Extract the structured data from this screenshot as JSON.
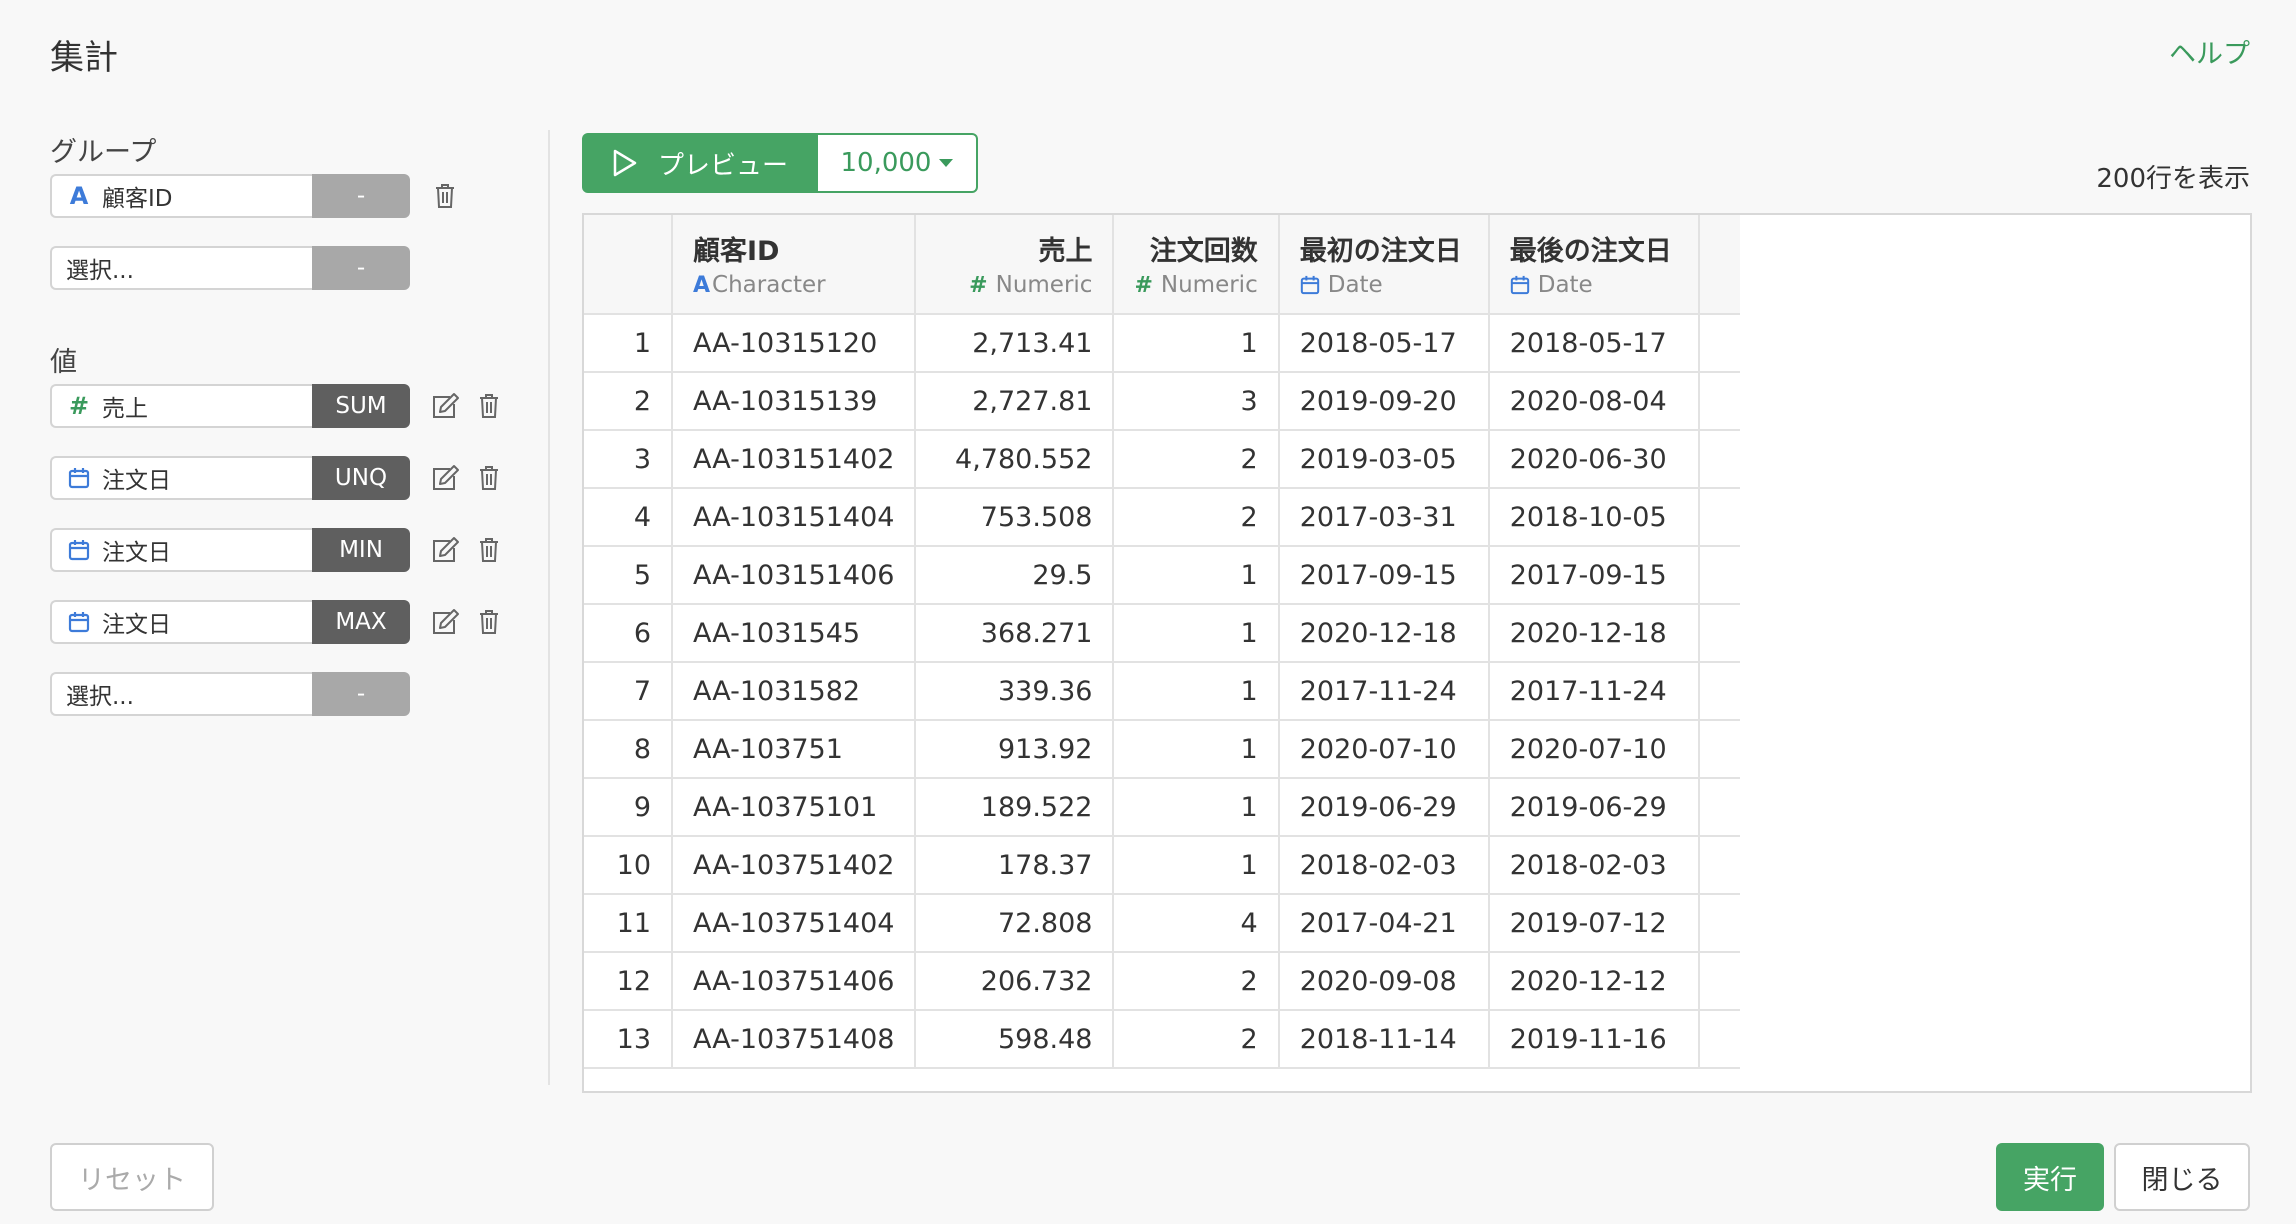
{
  "header": {
    "title": "集計",
    "help_label": "ヘルプ"
  },
  "group": {
    "label": "グループ",
    "items": [
      {
        "icon": "character-type-icon",
        "name": "顧客ID",
        "agg": "-"
      },
      {
        "icon": "",
        "name": "選択...",
        "agg": "-"
      }
    ]
  },
  "values": {
    "label": "値",
    "items": [
      {
        "icon": "numeric-type-icon",
        "name": "売上",
        "agg": "SUM"
      },
      {
        "icon": "date-type-icon",
        "name": "注文日",
        "agg": "UNQ"
      },
      {
        "icon": "date-type-icon",
        "name": "注文日",
        "agg": "MIN"
      },
      {
        "icon": "date-type-icon",
        "name": "注文日",
        "agg": "MAX"
      },
      {
        "icon": "",
        "name": "選択...",
        "agg": "-"
      }
    ]
  },
  "preview": {
    "button_label": "プレビュー",
    "rows_value": "10,000",
    "row_count_label": "200行を表示"
  },
  "table": {
    "columns": [
      {
        "name": "顧客ID",
        "type": "Character"
      },
      {
        "name": "売上",
        "type": "Numeric"
      },
      {
        "name": "注文回数",
        "type": "Numeric"
      },
      {
        "name": "最初の注文日",
        "type": "Date"
      },
      {
        "name": "最後の注文日",
        "type": "Date"
      }
    ],
    "rows": [
      [
        "1",
        "AA-10315120",
        "2,713.41",
        "1",
        "2018-05-17",
        "2018-05-17"
      ],
      [
        "2",
        "AA-10315139",
        "2,727.81",
        "3",
        "2019-09-20",
        "2020-08-04"
      ],
      [
        "3",
        "AA-103151402",
        "4,780.552",
        "2",
        "2019-03-05",
        "2020-06-30"
      ],
      [
        "4",
        "AA-103151404",
        "753.508",
        "2",
        "2017-03-31",
        "2018-10-05"
      ],
      [
        "5",
        "AA-103151406",
        "29.5",
        "1",
        "2017-09-15",
        "2017-09-15"
      ],
      [
        "6",
        "AA-1031545",
        "368.271",
        "1",
        "2020-12-18",
        "2020-12-18"
      ],
      [
        "7",
        "AA-1031582",
        "339.36",
        "1",
        "2017-11-24",
        "2017-11-24"
      ],
      [
        "8",
        "AA-103751",
        "913.92",
        "1",
        "2020-07-10",
        "2020-07-10"
      ],
      [
        "9",
        "AA-10375101",
        "189.522",
        "1",
        "2019-06-29",
        "2019-06-29"
      ],
      [
        "10",
        "AA-103751402",
        "178.37",
        "1",
        "2018-02-03",
        "2018-02-03"
      ],
      [
        "11",
        "AA-103751404",
        "72.808",
        "4",
        "2017-04-21",
        "2019-07-12"
      ],
      [
        "12",
        "AA-103751406",
        "206.732",
        "2",
        "2020-09-08",
        "2020-12-12"
      ],
      [
        "13",
        "AA-103751408",
        "598.48",
        "2",
        "2018-11-14",
        "2019-11-16"
      ]
    ]
  },
  "footer": {
    "reset_label": "リセット",
    "run_label": "実行",
    "close_label": "閉じる"
  },
  "colors": {
    "accent": "#46a464",
    "char_icon": "#3d7bd9",
    "agg_dark": "#5f5f5f",
    "agg_empty": "#a8a8a8"
  }
}
